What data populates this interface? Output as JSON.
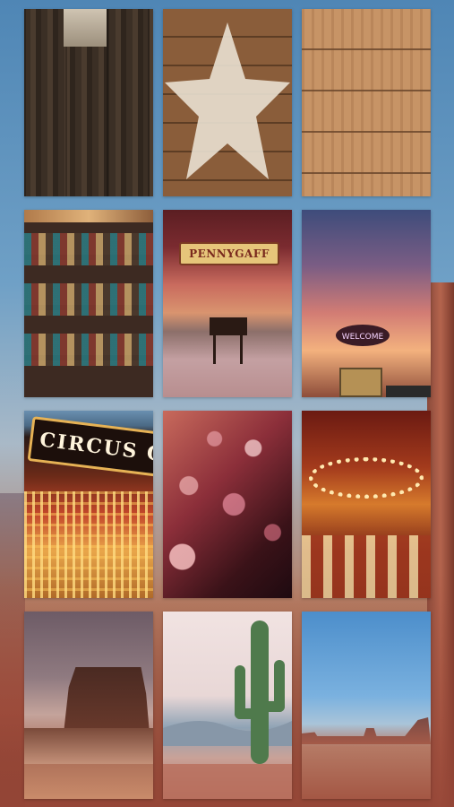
{
  "tiles": [
    {
      "row": 1,
      "col": 1,
      "name": "weathered-wood-tile"
    },
    {
      "row": 1,
      "col": 2,
      "name": "wood-star-tile"
    },
    {
      "row": 1,
      "col": 3,
      "name": "light-wood-planks-tile"
    },
    {
      "row": 2,
      "col": 1,
      "name": "cowboy-boots-tile"
    },
    {
      "row": 2,
      "col": 2,
      "name": "pennygaff-stage-tile"
    },
    {
      "row": 2,
      "col": 3,
      "name": "welcome-sign-sunset-tile"
    },
    {
      "row": 3,
      "col": 1,
      "name": "circus-marquee-tile"
    },
    {
      "row": 3,
      "col": 2,
      "name": "bokeh-lights-tile"
    },
    {
      "row": 3,
      "col": 3,
      "name": "carousel-tile"
    },
    {
      "row": 4,
      "col": 1,
      "name": "desert-butte-tile"
    },
    {
      "row": 4,
      "col": 2,
      "name": "saguaro-cactus-tile"
    },
    {
      "row": 4,
      "col": 3,
      "name": "monument-valley-tile"
    }
  ],
  "labels": {
    "pennygaff_banner": "PENNYGAFF",
    "circus_marquee": "CIRCUS C",
    "welcome_sign": "WELCOME"
  },
  "colors": {
    "sky_top": "#4f86b5",
    "desert_red": "#a3513f"
  }
}
